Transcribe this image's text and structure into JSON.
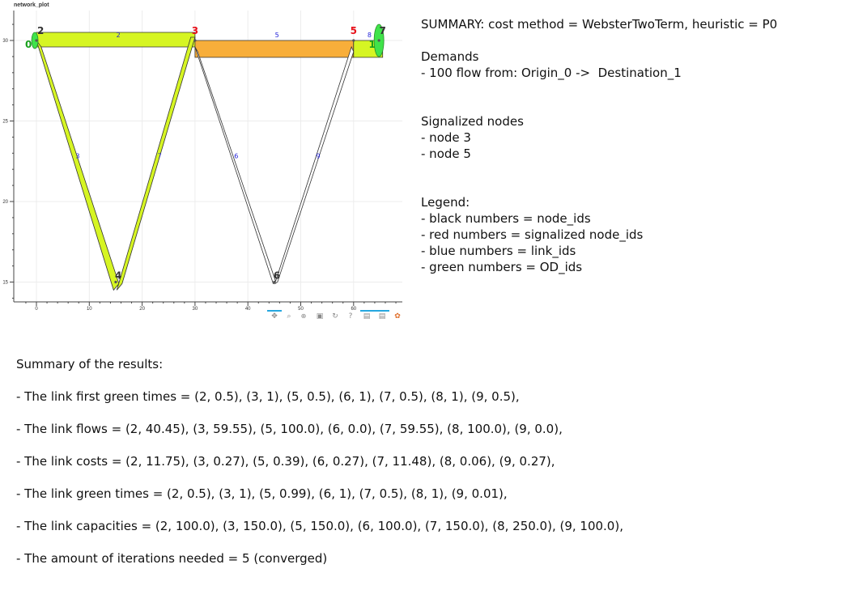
{
  "plot": {
    "title": "network_plot",
    "x_ticks": [
      "0",
      "10",
      "20",
      "30",
      "40",
      "50",
      "60"
    ],
    "y_ticks": [
      "15",
      "20",
      "25",
      "30"
    ],
    "nodes": [
      {
        "id": "0",
        "x": -1.5,
        "y": 29.7,
        "color": "black"
      },
      {
        "id": "2",
        "x": 0.8,
        "y": 30.4,
        "color": "black"
      },
      {
        "id": "3",
        "x": 30,
        "y": 30.4,
        "color": "red"
      },
      {
        "id": "5",
        "x": 60,
        "y": 30.4,
        "color": "red"
      },
      {
        "id": "1",
        "x": 63.5,
        "y": 29.7,
        "color": "black"
      },
      {
        "id": "7",
        "x": 65.5,
        "y": 30.4,
        "color": "black"
      },
      {
        "id": "4",
        "x": 15.5,
        "y": 15.2,
        "color": "black"
      },
      {
        "id": "6",
        "x": 45.5,
        "y": 15.2,
        "color": "black"
      }
    ],
    "link_labels": [
      {
        "id": "2",
        "x": 15.5,
        "y": 30.2
      },
      {
        "id": "5",
        "x": 45.5,
        "y": 30.2
      },
      {
        "id": "8",
        "x": 63,
        "y": 30.2
      },
      {
        "id": "3",
        "x": 7.8,
        "y": 22.7
      },
      {
        "id": "7",
        "x": 23.3,
        "y": 22.7
      },
      {
        "id": "6",
        "x": 37.8,
        "y": 22.7
      },
      {
        "id": "9",
        "x": 53.3,
        "y": 22.7
      }
    ],
    "od_labels": [
      {
        "id": "0",
        "x": -1.5,
        "y": 29.7
      },
      {
        "id": "1",
        "x": 63.5,
        "y": 29.7
      }
    ],
    "toolbar_icons": [
      "pan-icon",
      "box-zoom-icon",
      "wheel-zoom-icon",
      "save-icon",
      "reset-icon",
      "help-icon",
      "hover-icon",
      "hover2-icon",
      "bokeh-logo-icon"
    ]
  },
  "info": {
    "summary": "SUMMARY: cost method = WebsterTwoTerm, heuristic = P0",
    "demands_title": "Demands",
    "demands": [
      "- 100 flow from: Origin_0 ->  Destination_1"
    ],
    "signalized_title": "Signalized nodes",
    "signalized": [
      "- node 3",
      "- node 5"
    ],
    "legend_title": "Legend:",
    "legend": [
      "- black numbers = node_ids",
      "- red numbers = signalized node_ids",
      "- blue numbers = link_ids",
      "- green numbers = OD_ids"
    ]
  },
  "results": {
    "title": "Summary of the results:",
    "lines": [
      "- The link first green times = (2, 0.5), (3, 1), (5, 0.5), (6, 1), (7, 0.5), (8, 1), (9, 0.5),",
      "- The link flows = (2, 40.45), (3, 59.55), (5, 100.0), (6, 0.0), (7, 59.55), (8, 100.0), (9, 0.0),",
      "- The link costs = (2, 11.75), (3, 0.27), (5, 0.39), (6, 0.27), (7, 11.48), (8, 0.06), (9, 0.27),",
      "- The link green times = (2, 0.5), (3, 1), (5, 0.99), (6, 1), (7, 0.5), (8, 1), (9, 0.01),",
      "- The link capacities = (2, 100.0), (3, 150.0), (5, 150.0), (6, 100.0), (7, 150.0), (8, 250.0), (9, 100.0),",
      "- The amount of iterations needed = 5 (converged)"
    ]
  },
  "colors": {
    "link_yellow": "#d6f523",
    "link_orange": "#f8ae3a",
    "link_white": "#ffffff",
    "od_green": "#3fe34a",
    "node_red": "#e8101a",
    "link_blue": "#1d1dd8",
    "od_text_green": "#18a01c"
  }
}
